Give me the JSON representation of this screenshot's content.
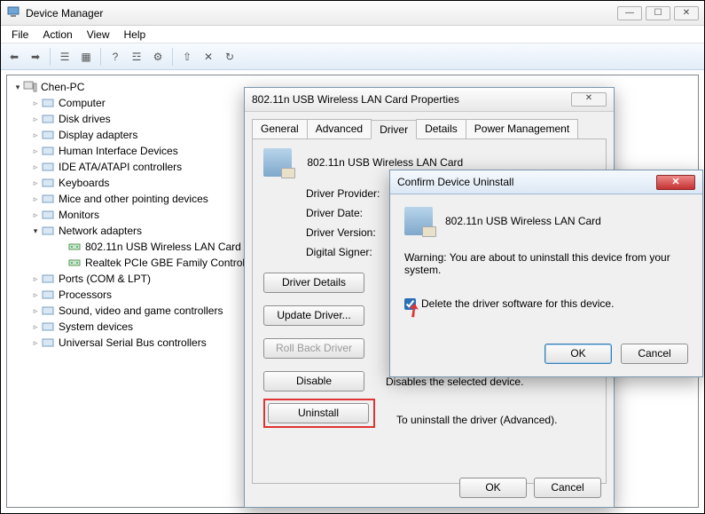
{
  "window": {
    "title": "Device Manager"
  },
  "menu": {
    "file": "File",
    "action": "Action",
    "view": "View",
    "help": "Help"
  },
  "tree": {
    "root": "Chen-PC",
    "items": [
      "Computer",
      "Disk drives",
      "Display adapters",
      "Human Interface Devices",
      "IDE ATA/ATAPI controllers",
      "Keyboards",
      "Mice and other pointing devices",
      "Monitors",
      "Network adapters",
      "Ports (COM & LPT)",
      "Processors",
      "Sound, video and game controllers",
      "System devices",
      "Universal Serial Bus controllers"
    ],
    "network_children": [
      "802.11n USB Wireless LAN Card",
      "Realtek PCIe GBE Family Controller"
    ]
  },
  "props": {
    "title": "802.11n USB Wireless LAN Card Properties",
    "tabs": {
      "general": "General",
      "advanced": "Advanced",
      "driver": "Driver",
      "details": "Details",
      "power": "Power Management"
    },
    "device_name": "802.11n USB Wireless LAN Card",
    "labels": {
      "provider": "Driver Provider:",
      "date": "Driver Date:",
      "version": "Driver Version:",
      "signer": "Digital Signer:"
    },
    "buttons": {
      "details": "Driver Details",
      "update": "Update Driver...",
      "rollback": "Roll Back Driver",
      "disable": "Disable",
      "uninstall": "Uninstall",
      "ok": "OK",
      "cancel": "Cancel"
    },
    "desc": {
      "disable": "Disables the selected device.",
      "uninstall": "To uninstall the driver (Advanced)."
    }
  },
  "confirm": {
    "title": "Confirm Device Uninstall",
    "device": "802.11n USB Wireless LAN Card",
    "warning": "Warning: You are about to uninstall this device from your system.",
    "checkbox": "Delete the driver software for this device.",
    "ok": "OK",
    "cancel": "Cancel"
  }
}
